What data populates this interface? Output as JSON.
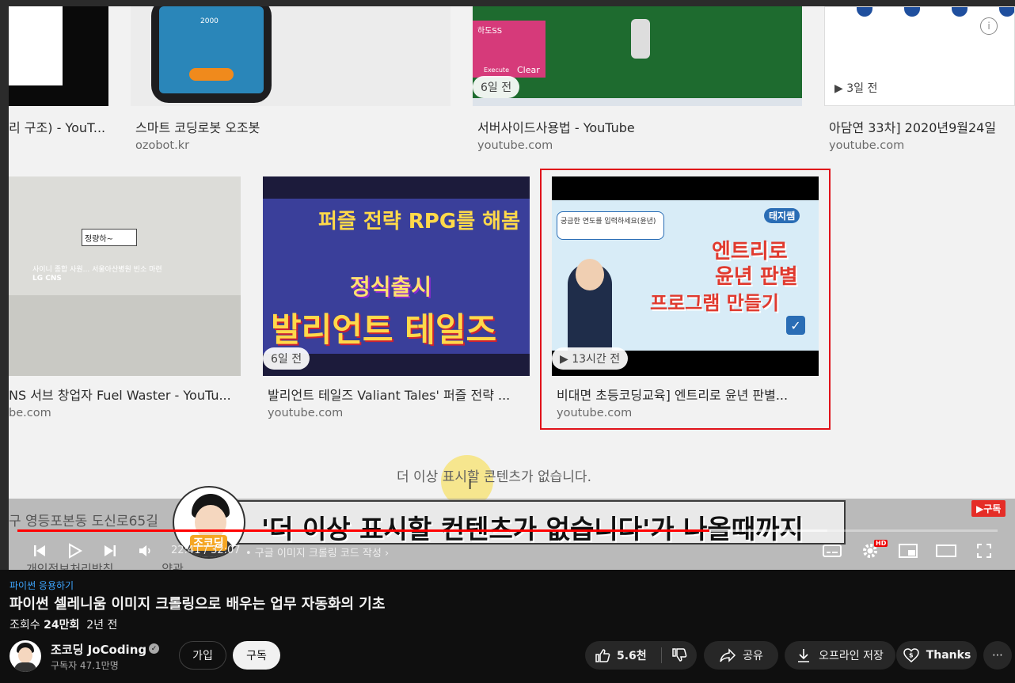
{
  "results": {
    "row1": [
      {
        "title": "리 구조) - YouT...",
        "source": ""
      },
      {
        "title": "스마트 코딩로봇 오조봇",
        "source": "ozobot.kr"
      },
      {
        "title": "서버사이드사용법 - YouTube",
        "source": "youtube.com",
        "badge": "6일 전"
      },
      {
        "title": "아담연 33차] 2020년9월24일 ",
        "source": "youtube.com",
        "badge": "▶ 3일 전"
      }
    ],
    "row2": [
      {
        "title": "NS 서브 창업자 Fuel Waster - YouTu...",
        "source": "be.com"
      },
      {
        "title": "발리언트 테일즈 Valiant Tales' 퍼즐 전략 ...",
        "source": "youtube.com",
        "badge": "6일 전"
      },
      {
        "title": "비대면 초등코딩교육] 엔트리로 윤년 판별...",
        "source": "youtube.com",
        "badge": "▶ 13시간 전"
      }
    ],
    "thumb_texts": {
      "phone_score": "2000",
      "pink_box": "하도SS",
      "pink_btn1": "Execute",
      "pink_btn2": "Clear",
      "office_sign": "정량하~",
      "office_caption": "사이니 종합 사원... 서울아산병원 빈소 마련",
      "office_logo": "LG CNS",
      "game_top": "퍼즐 전략 RPG를 해봄",
      "game_mid": "정식출시",
      "game_big": "발리언트 테일즈",
      "entry_bubble": "궁금한 연도를 입력하세요(윤년)",
      "entry_tag": "태지쌤",
      "entry_title1": "엔트리로",
      "entry_title2": "윤년 판별",
      "entry_title3": "프로그램 만들기"
    },
    "no_more": "더 이상 표시할 콘텐츠가 없습니다.",
    "street": "구 영등포본동 도신로65길 ",
    "footer_links": [
      "개인정보처리방침",
      "약관"
    ]
  },
  "overlay": {
    "caption": "'더 이상 표시할 컨텐츠가 없습니다'가 나올때까지",
    "avatar_label": "조코딩",
    "subscribe_badge": "▶구독"
  },
  "player": {
    "time": "22:41 / 32:07",
    "chapter": "• 구글 이미지 크롤링 코드 작성",
    "progress_fraction": 0.706,
    "hd_label": "HD",
    "info_icon": "i"
  },
  "video": {
    "hashtag": "파이썬 응용하기",
    "title": "파이썬 셀레니움 이미지 크롤링으로 배우는 업무 자동화의 기초",
    "views_label": "조회수",
    "views": "24만회",
    "age": "2년 전"
  },
  "channel": {
    "name": "조코딩 JoCoding",
    "subscribers": "구독자 47.1만명",
    "join_label": "가입",
    "subscribe_label": "구독"
  },
  "actions": {
    "likes": "5.6천",
    "share": "공유",
    "offline": "오프라인 저장",
    "thanks": "Thanks",
    "more": "⋯"
  },
  "colors": {
    "accent_red": "#ff0000",
    "highlight_box": "#e0121a",
    "link_blue": "#3ea6ff",
    "background": "#0f0f0f"
  }
}
